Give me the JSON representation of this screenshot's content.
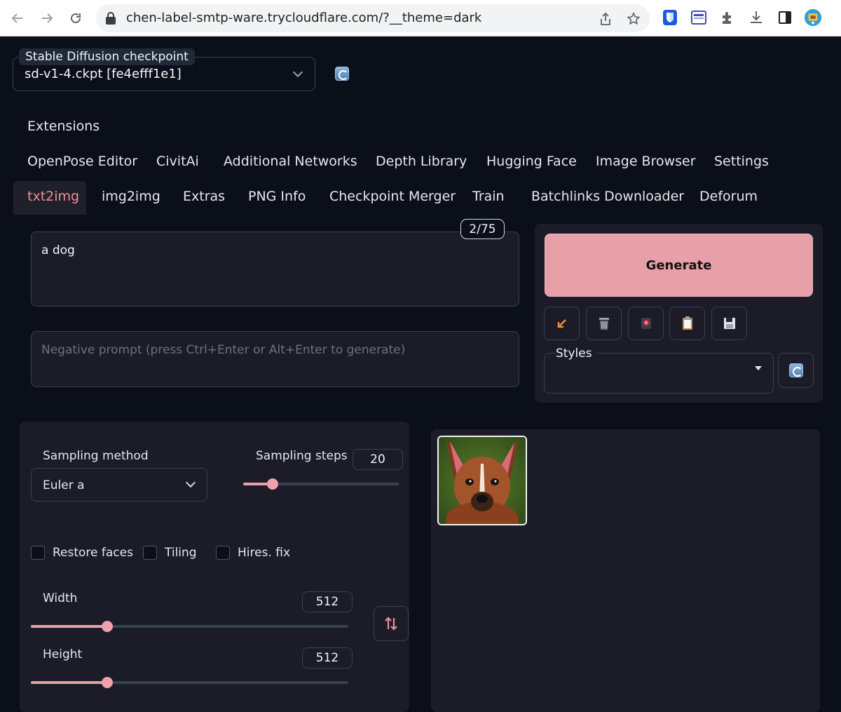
{
  "browser": {
    "url": "chen-label-smtp-ware.trycloudflare.com/?__theme=dark"
  },
  "checkpoint": {
    "label": "Stable Diffusion checkpoint",
    "value": "sd-v1-4.ckpt [fe4efff1e1]"
  },
  "tabs_row1": [
    "Extensions"
  ],
  "tabs_row2": [
    "OpenPose Editor",
    "CivitAi",
    "Additional Networks",
    "Depth Library",
    "Hugging Face",
    "Image Browser",
    "Settings"
  ],
  "tabs_row3": [
    "txt2img",
    "img2img",
    "Extras",
    "PNG Info",
    "Checkpoint Merger",
    "Train",
    "Batchlinks Downloader",
    "Deforum"
  ],
  "active_tab": "txt2img",
  "prompt": {
    "value": "a dog",
    "token_count": "2/75"
  },
  "negative_prompt": {
    "placeholder": "Negative prompt (press Ctrl+Enter or Alt+Enter to generate)"
  },
  "generate": {
    "label": "Generate"
  },
  "styles": {
    "label": "Styles"
  },
  "sampling": {
    "method_label": "Sampling method",
    "method_value": "Euler a",
    "steps_label": "Sampling steps",
    "steps_value": "20",
    "steps_fraction": 0.19
  },
  "checkboxes": {
    "restore_faces": "Restore faces",
    "tiling": "Tiling",
    "hires_fix": "Hires. fix"
  },
  "width": {
    "label": "Width",
    "value": "512",
    "fraction": 0.24
  },
  "height": {
    "label": "Height",
    "value": "512",
    "fraction": 0.24
  },
  "icons": {
    "back": "arrow-left-icon",
    "forward": "arrow-right-icon",
    "reload": "reload-icon",
    "share": "share-icon",
    "bookmark": "star-icon",
    "swap": "swap-vertical-icon"
  },
  "colors": {
    "accent": "#e8a0a8",
    "active_tab": "#f28b9c",
    "background": "#0b0f19",
    "panel": "#1c1c28"
  }
}
